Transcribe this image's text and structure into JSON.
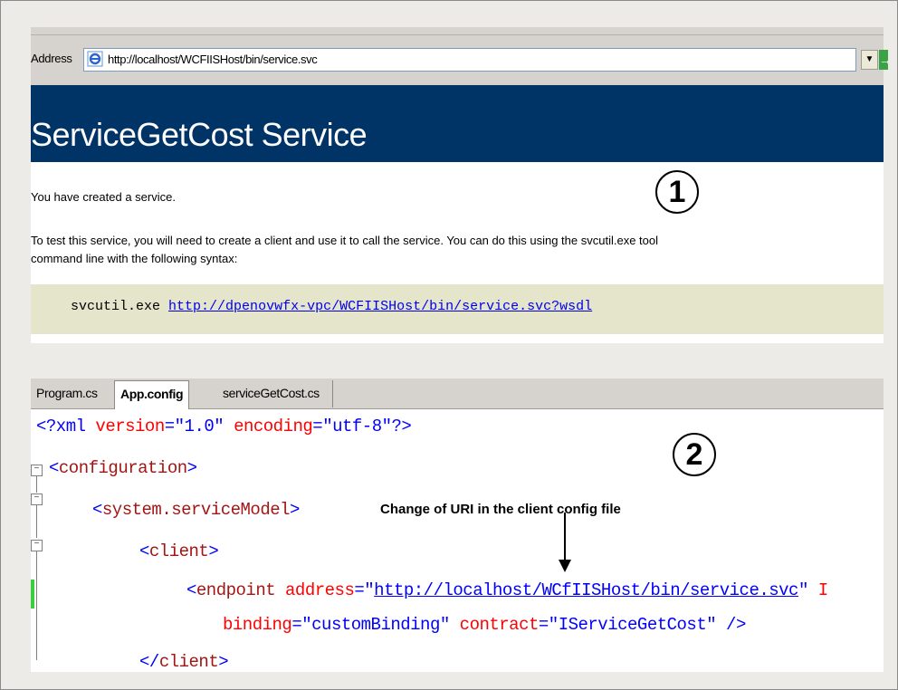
{
  "browser": {
    "address_label": "Address",
    "url": "http://localhost/WCFIISHost/bin/service.svc",
    "dropdown_glyph": "▼",
    "go_glyph": "→"
  },
  "service_page": {
    "title": "ServiceGetCost Service",
    "created_text": "You have created a service.",
    "test_text": "To test this service, you will need to create a client and use it to call the service. You can do this using the svcutil.exe tool",
    "test_text_2": "command line with the following syntax:",
    "command": "svcutil.exe",
    "wsdl_link": "http://dpenovwfx-vpc/WCFIISHost/bin/service.svc?wsdl"
  },
  "callouts": {
    "one": "1",
    "two": "2"
  },
  "editor": {
    "tabs": [
      "Program.cs",
      "App.config",
      "serviceGetCost.cs"
    ],
    "active_tab": "App.config",
    "lines": {
      "xml_decl_open": "<?xml ",
      "xml_version_attr": "version",
      "xml_version_val": "\"1.0\"",
      "xml_encoding_attr": "encoding",
      "xml_encoding_val": "\"utf-8\"",
      "xml_decl_close": "?>",
      "configuration": "configuration",
      "system_service_model": "system.serviceModel",
      "client": "client",
      "endpoint": "endpoint",
      "address_attr": "address",
      "address_val": "http://localhost/WCfIISHost/bin/service.svc",
      "binding_attr": "binding",
      "binding_val": "\"customBinding\"",
      "contract_attr": "contract",
      "contract_val": "\"IServiceGetCost\"",
      "client_close": "client"
    }
  },
  "annotation": {
    "text": "Change of URI in the client config file"
  },
  "colors": {
    "header_bg": "#003366",
    "code_box_bg": "#e5e5cc",
    "link": "#0000ee",
    "xml_tag": "#a31515",
    "xml_attr": "#ff0000",
    "xml_value": "#0000ff"
  }
}
